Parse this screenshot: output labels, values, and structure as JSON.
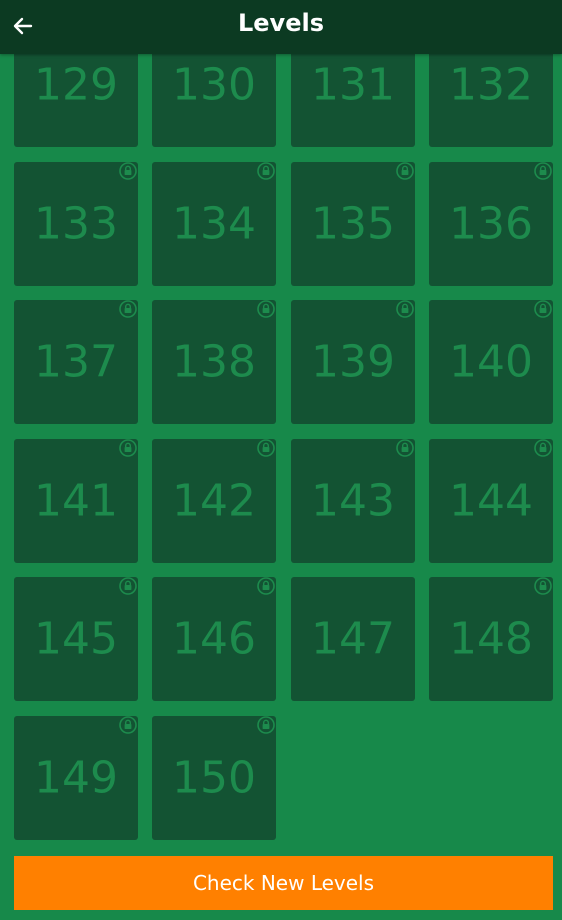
{
  "header": {
    "title": "Levels",
    "back_icon": "arrow-left-icon"
  },
  "levels": [
    {
      "number": "129",
      "locked": false
    },
    {
      "number": "130",
      "locked": false
    },
    {
      "number": "131",
      "locked": false
    },
    {
      "number": "132",
      "locked": false
    },
    {
      "number": "133",
      "locked": true
    },
    {
      "number": "134",
      "locked": true
    },
    {
      "number": "135",
      "locked": true
    },
    {
      "number": "136",
      "locked": true
    },
    {
      "number": "137",
      "locked": true
    },
    {
      "number": "138",
      "locked": true
    },
    {
      "number": "139",
      "locked": true
    },
    {
      "number": "140",
      "locked": true
    },
    {
      "number": "141",
      "locked": true
    },
    {
      "number": "142",
      "locked": true
    },
    {
      "number": "143",
      "locked": true
    },
    {
      "number": "144",
      "locked": true
    },
    {
      "number": "145",
      "locked": true
    },
    {
      "number": "146",
      "locked": true
    },
    {
      "number": "147",
      "locked": false
    },
    {
      "number": "148",
      "locked": true
    },
    {
      "number": "149",
      "locked": true
    },
    {
      "number": "150",
      "locked": true
    }
  ],
  "footer": {
    "check_new_levels_label": "Check New Levels"
  },
  "colors": {
    "background": "#17894a",
    "header": "#0c3a22",
    "tile": "#135333",
    "tile_text": "#1d8b4d",
    "button": "#ff8000"
  }
}
